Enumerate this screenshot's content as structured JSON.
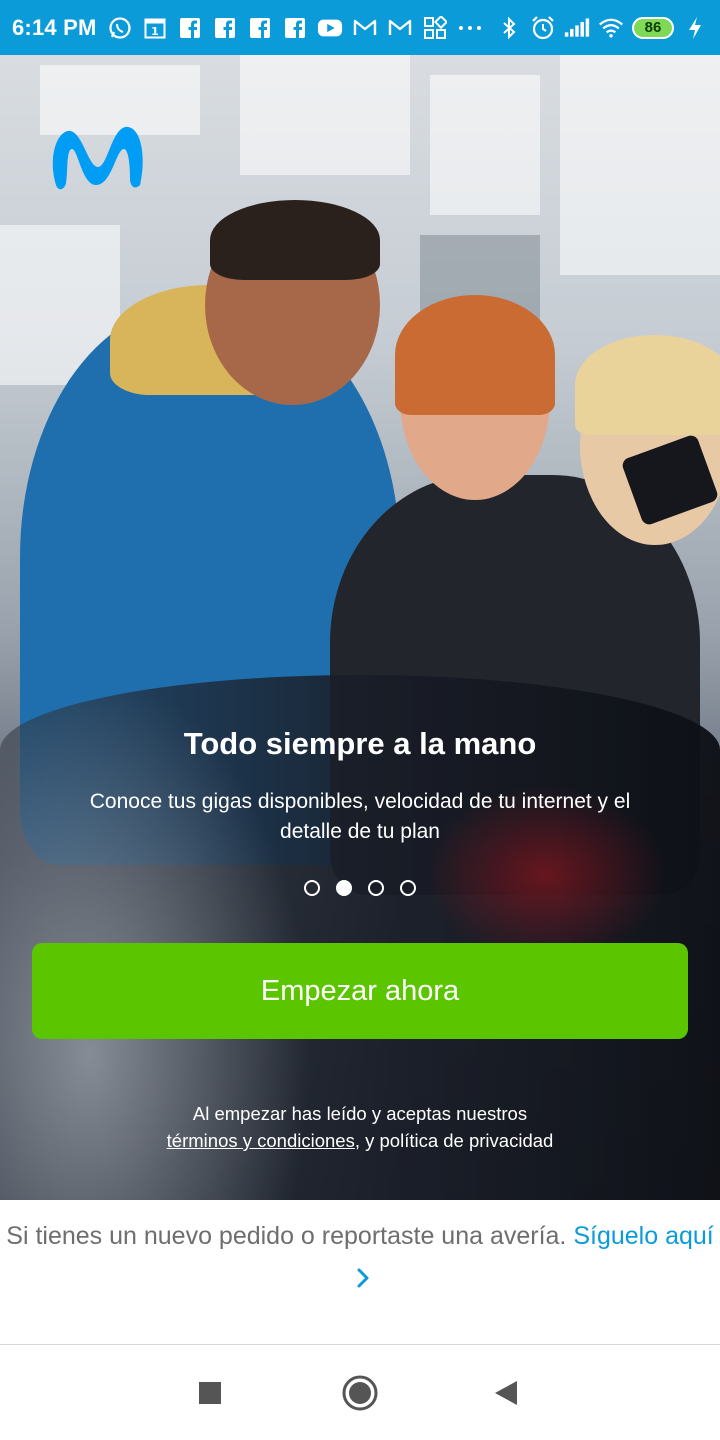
{
  "status_bar": {
    "time": "6:14 PM",
    "battery": "86",
    "notification_icons": [
      "whatsapp-icon",
      "calendar-icon",
      "facebook-icon",
      "facebook-icon",
      "facebook-icon",
      "facebook-icon",
      "youtube-icon",
      "gmail-icon",
      "gmail-icon",
      "apps-icon",
      "more-icon"
    ],
    "system_icons": [
      "bluetooth-icon",
      "alarm-icon",
      "signal-icon",
      "wifi-icon",
      "battery-icon",
      "charging-icon"
    ],
    "calendar_day": "1"
  },
  "colors": {
    "status_bar": "#0b9bd9",
    "brand_blue": "#019df4",
    "cta_green": "#5bc500",
    "link_blue": "#0b9bd9"
  },
  "onboarding": {
    "headline": "Todo siempre a la mano",
    "subtext": "Conoce tus gigas disponibles, velocidad de tu internet y el detalle de tu plan",
    "pages_total": 4,
    "active_page": 2,
    "cta_label": "Empezar ahora",
    "terms_line1": "Al empezar has leído y aceptas nuestros",
    "terms_link": "términos y condiciones",
    "terms_rest": ", y política de privacidad"
  },
  "footer": {
    "text": "Si tienes un nuevo pedido o reportaste una avería.",
    "link": "Síguelo aquí"
  },
  "nav_bar": {
    "buttons": [
      "recents-button",
      "home-button",
      "back-button"
    ]
  }
}
